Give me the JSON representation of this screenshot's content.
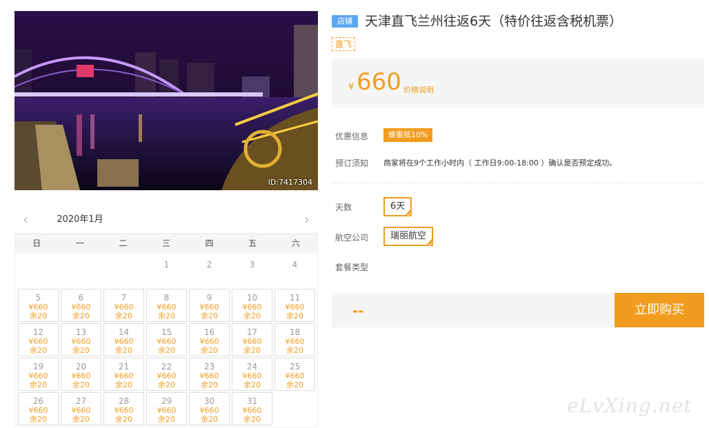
{
  "photo": {
    "id_label": "ID:7417304",
    "alt": "photo"
  },
  "calendar": {
    "month_label": "2020年1月",
    "weekdays": [
      "日",
      "一",
      "二",
      "三",
      "四",
      "五",
      "六"
    ],
    "leading_plain_days": [
      "",
      "",
      "",
      "1",
      "2",
      "3",
      "4"
    ],
    "price": "¥660",
    "stock": "余20",
    "available_days": [
      "5",
      "6",
      "7",
      "8",
      "9",
      "10",
      "11",
      "12",
      "13",
      "14",
      "15",
      "16",
      "17",
      "18",
      "19",
      "20",
      "21",
      "22",
      "23",
      "24",
      "25",
      "26",
      "27",
      "28",
      "29",
      "30",
      "31"
    ]
  },
  "header": {
    "shop_badge": "店铺",
    "title": "天津直飞兰州往返6天（特价往返含税机票）",
    "direct_tag": "直飞"
  },
  "price": {
    "currency": "¥",
    "amount": "660",
    "explain": "价格说明"
  },
  "info": {
    "promo_label": "优惠信息",
    "promo_tag": "蜂蜜抵10%",
    "notice_label": "预订须知",
    "notice_text": "商家将在9个工作小时内（ 工作日9:00-18:00 ）确认是否预定成功。"
  },
  "options": {
    "days_label": "天数",
    "days_value": "6天",
    "airline_label": "航空公司",
    "airline_value": "瑞丽航空",
    "package_label": "套餐类型"
  },
  "purchase": {
    "total": "--",
    "buy_label": "立即购买"
  },
  "watermark": "eLvXing.net",
  "colors": {
    "accent": "#f29c1f",
    "badge": "#5ea8f0"
  }
}
